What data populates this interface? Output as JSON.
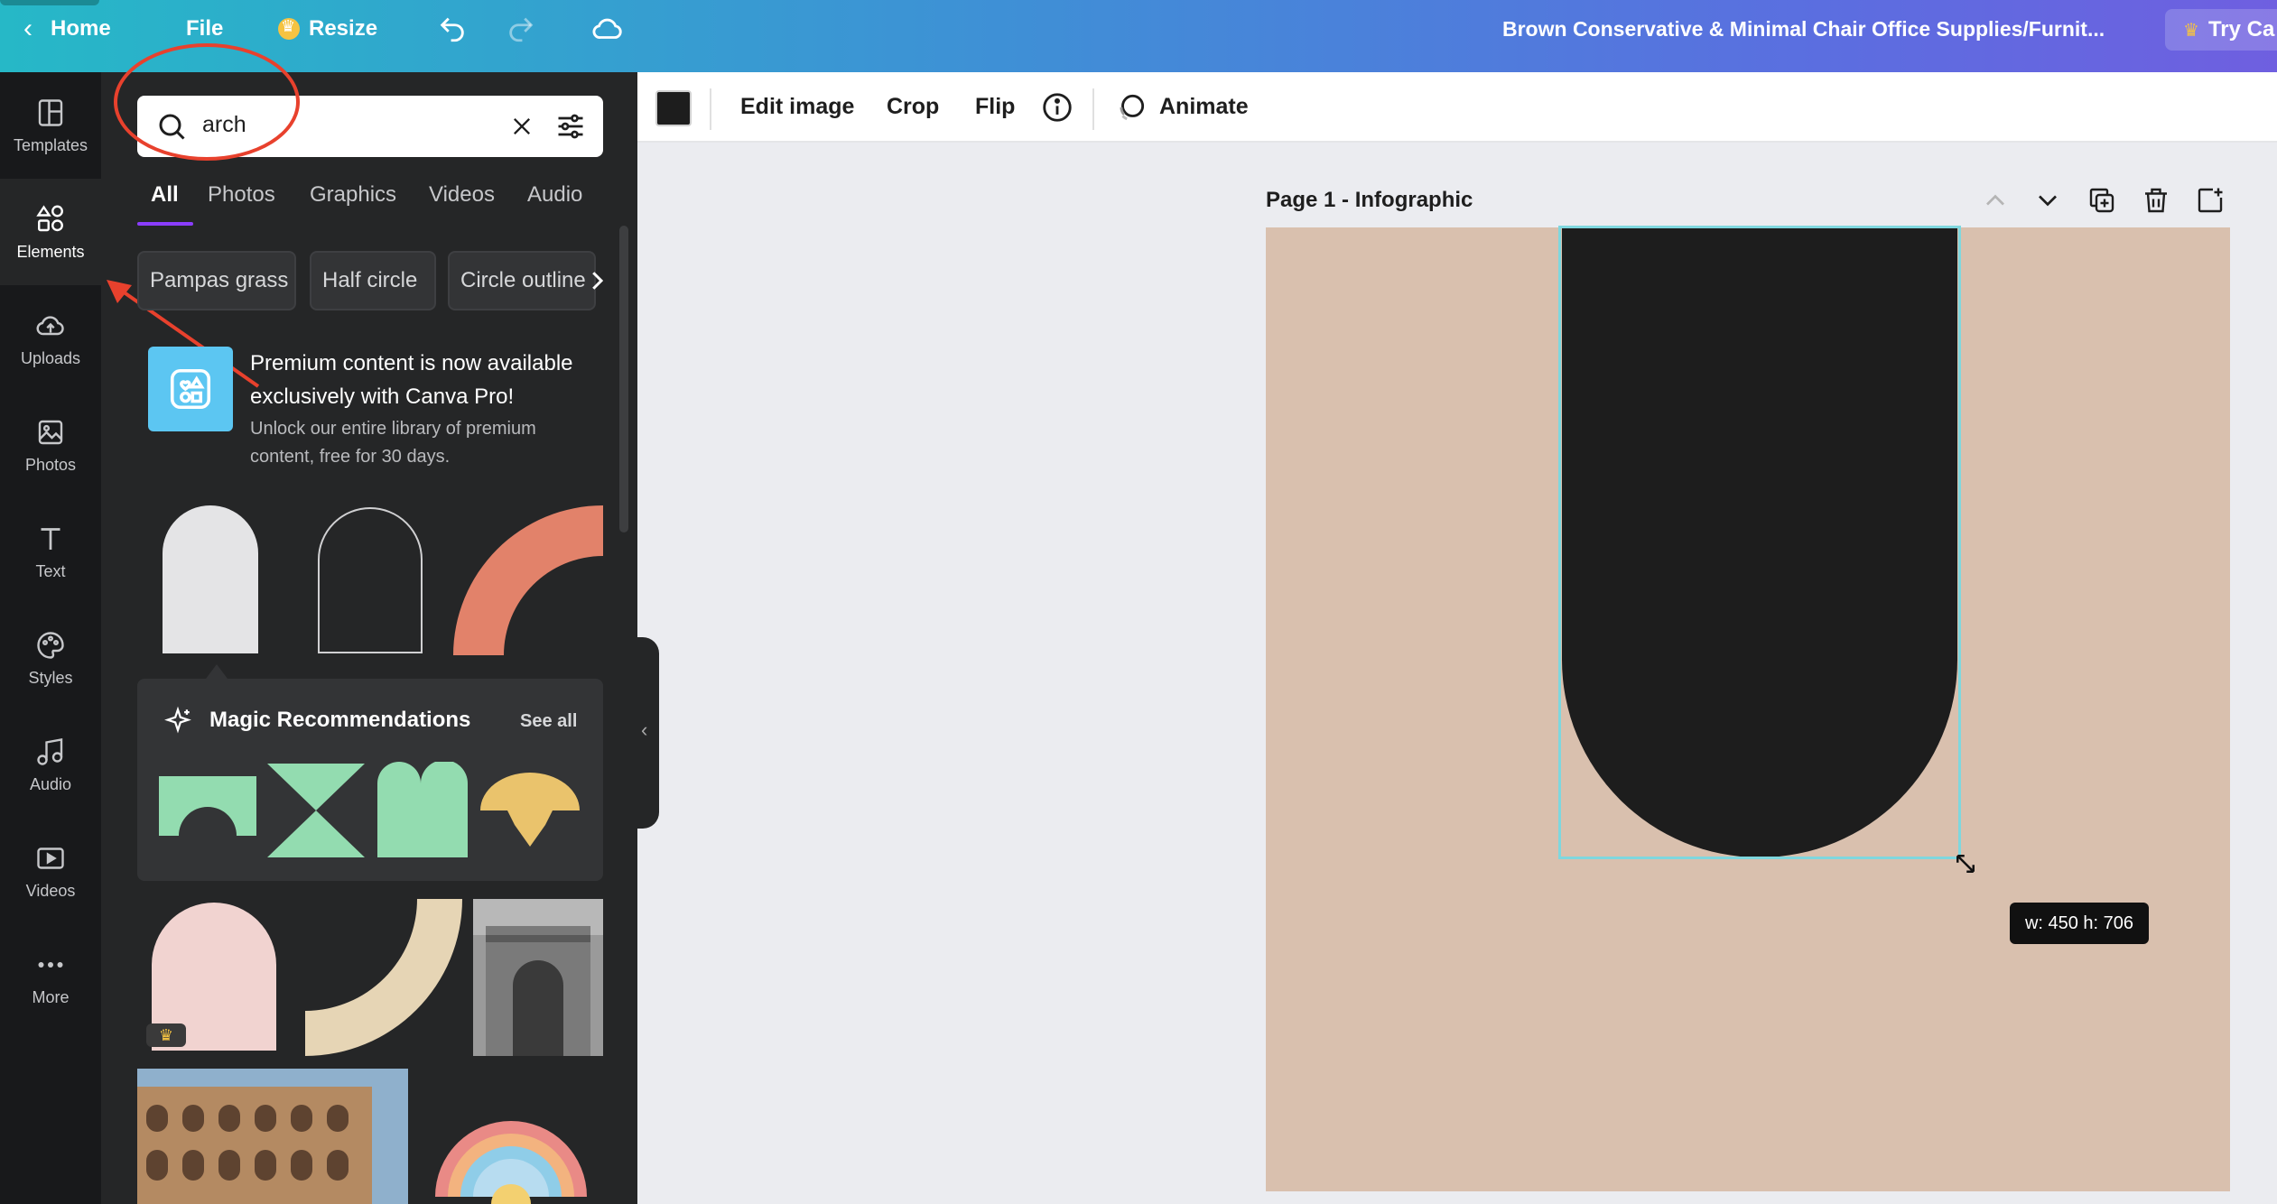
{
  "topbar": {
    "home_label": "Home",
    "file_label": "File",
    "resize_label": "Resize",
    "doc_title": "Brown Conservative & Minimal Chair Office Supplies/Furnit...",
    "try_label": "Try Ca"
  },
  "rail": {
    "items": [
      {
        "label": "Templates",
        "icon": "templates-icon"
      },
      {
        "label": "Elements",
        "icon": "elements-icon"
      },
      {
        "label": "Uploads",
        "icon": "upload-cloud-icon"
      },
      {
        "label": "Photos",
        "icon": "photo-icon"
      },
      {
        "label": "Text",
        "icon": "text-icon"
      },
      {
        "label": "Styles",
        "icon": "palette-icon"
      },
      {
        "label": "Audio",
        "icon": "music-note-icon"
      },
      {
        "label": "Videos",
        "icon": "video-icon"
      },
      {
        "label": "More",
        "icon": "more-dots-icon"
      }
    ]
  },
  "search": {
    "value": "arch"
  },
  "tabs": [
    "All",
    "Photos",
    "Graphics",
    "Videos",
    "Audio"
  ],
  "chips": [
    "Pampas grass",
    "Half circle",
    "Circle outline"
  ],
  "promo": {
    "title": "Premium content is now available exclusively with Canva Pro!",
    "subtitle": "Unlock our entire library of premium content, free for 30 days."
  },
  "magic": {
    "title": "Magic Recommendations",
    "see_all": "See all"
  },
  "toolbar": {
    "edit_image": "Edit image",
    "crop": "Crop",
    "flip": "Flip",
    "animate": "Animate"
  },
  "canvas": {
    "page_label": "Page 1 - Infographic",
    "dimensions": "w: 450 h: 706"
  },
  "colors": {
    "panel_bg": "#252627",
    "page_bg": "#d9c0ae",
    "arch_fill": "#1d1d1d",
    "selection": "#7fd7de",
    "annotation": "#e8412d"
  }
}
